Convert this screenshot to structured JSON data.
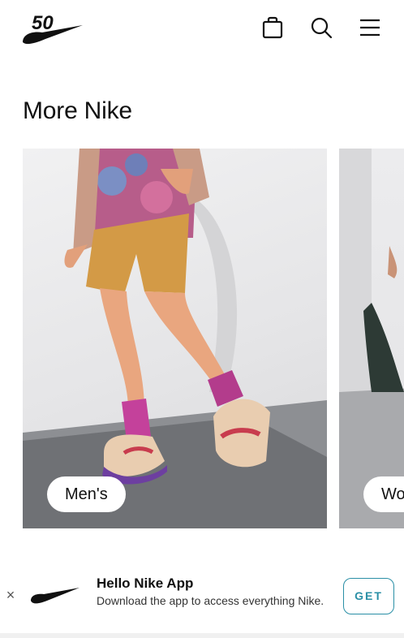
{
  "header": {
    "logo_icon": "nike-50-logo-icon",
    "logo_text": "50",
    "bag_icon": "shopping-bag-icon",
    "search_icon": "search-icon",
    "menu_icon": "hamburger-menu-icon"
  },
  "section": {
    "title": "More Nike",
    "cards": [
      {
        "label": "Men's"
      },
      {
        "label": "Wo"
      }
    ]
  },
  "app_banner": {
    "close_symbol": "×",
    "title": "Hello Nike App",
    "subtitle": "Download the app to access everything Nike.",
    "get_label": "GET",
    "accent_color": "#2a8fa6"
  }
}
